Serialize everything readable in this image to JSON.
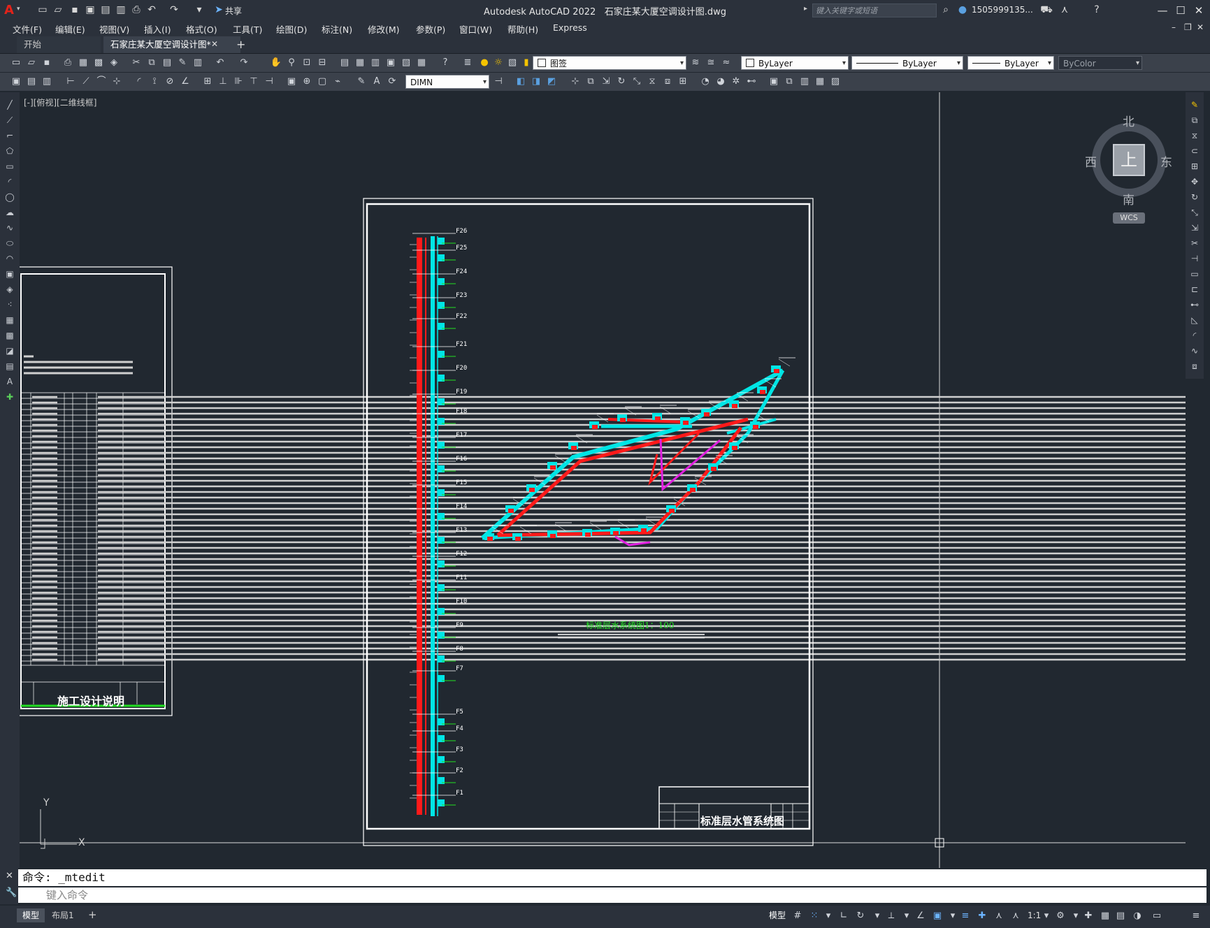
{
  "app": {
    "title": "Autodesk AutoCAD 2022",
    "document": "石家庄某大厦空调设计图.dwg",
    "share_label": "共享",
    "search_placeholder": "键入关键字或短语",
    "user": "1505999135...",
    "window_controls": [
      "minimize-icon",
      "maximize-icon",
      "close-icon"
    ]
  },
  "menu": [
    "文件(F)",
    "编辑(E)",
    "视图(V)",
    "插入(I)",
    "格式(O)",
    "工具(T)",
    "绘图(D)",
    "标注(N)",
    "修改(M)",
    "参数(P)",
    "窗口(W)",
    "帮助(H)",
    "Express"
  ],
  "tabs": [
    {
      "label": "开始",
      "active": false
    },
    {
      "label": "石家庄某大厦空调设计图*",
      "active": true
    }
  ],
  "toolbar": {
    "layer": "图签",
    "color": "ByLayer",
    "linetype": "ByLayer",
    "lineweight": "ByLayer",
    "plotstyle": "ByColor",
    "dimstyle": "DIMN"
  },
  "viewport_label": "[-][俯视][二维线框]",
  "viewcube": {
    "north": "北",
    "south": "南",
    "east": "东",
    "west": "西",
    "face": "上",
    "wcs": "WCS"
  },
  "drawing": {
    "title": "标准层水系统图1：100",
    "title_block": "标准层水管系统图",
    "left_sheet_title": "施工设计说明",
    "floors": [
      "F26",
      "F25",
      "F24",
      "F23",
      "F22",
      "F21",
      "F20",
      "F19",
      "F18",
      "F17",
      "F16",
      "F15",
      "F14",
      "F13",
      "F12",
      "F11",
      "F10",
      "F9",
      "F8",
      "F7",
      "F5",
      "F4",
      "F3",
      "F2",
      "F1"
    ]
  },
  "command": {
    "history": "命令: _mtedit",
    "prompt": "键入命令"
  },
  "status": {
    "tabs": [
      "模型",
      "布局1"
    ],
    "scale": "1:1"
  },
  "colors": {
    "red_pipe": "#ff1a1a",
    "cyan_pipe": "#00e5e5",
    "magenta_pipe": "#e020e0",
    "label_green": "#22e022",
    "background": "#212830"
  }
}
